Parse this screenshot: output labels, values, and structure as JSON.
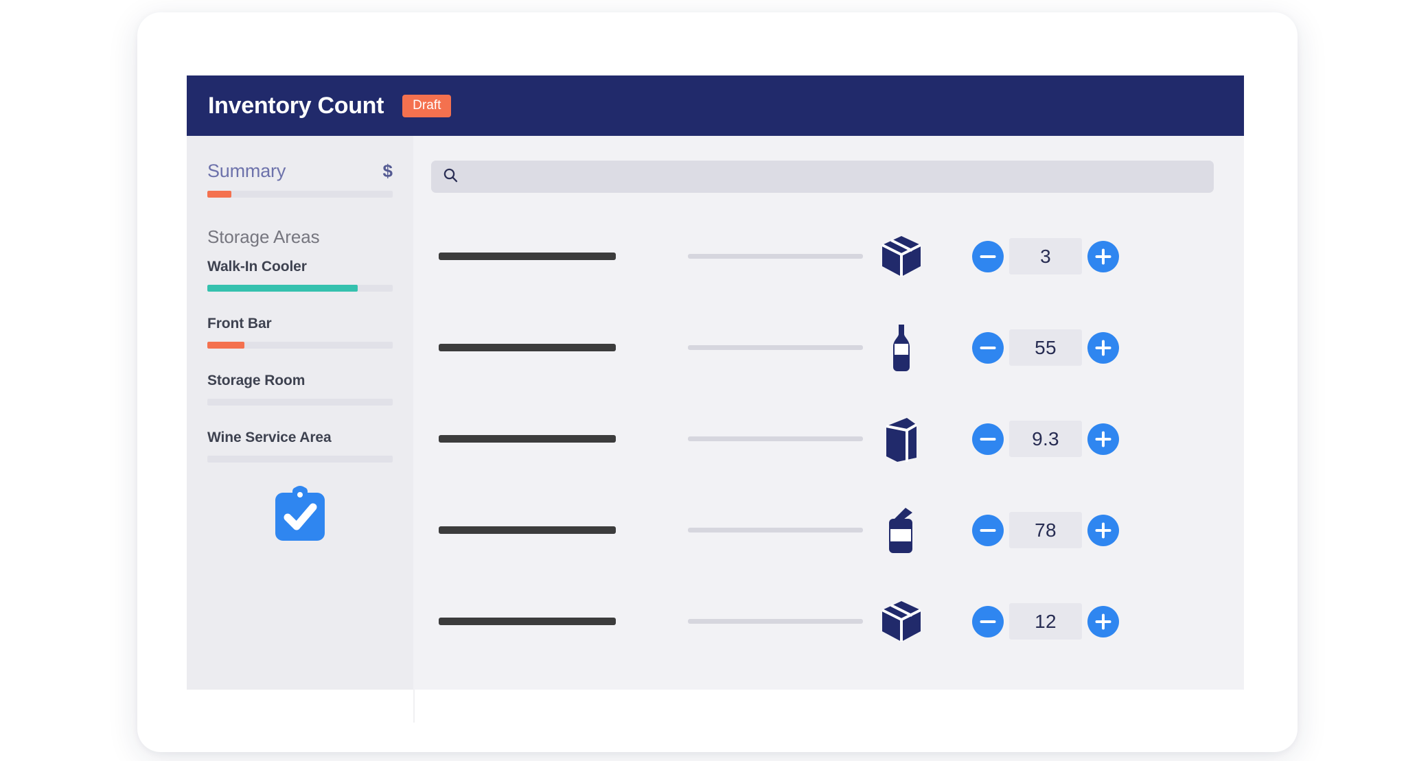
{
  "header": {
    "title": "Inventory Count",
    "status_badge": "Draft",
    "bg_color": "#212a6b",
    "badge_color": "#f4714f"
  },
  "sidebar": {
    "summary": {
      "label": "Summary",
      "currency_icon": "dollar-icon",
      "progress_percent": 13,
      "progress_color": "#f4714f"
    },
    "section_title": "Storage Areas",
    "areas": [
      {
        "name": "Walk-In Cooler",
        "progress_percent": 81,
        "progress_color": "#35c1ae"
      },
      {
        "name": "Front Bar",
        "progress_percent": 20,
        "progress_color": "#f4714f"
      },
      {
        "name": "Storage Room",
        "progress_percent": 0,
        "progress_color": "#e1e1e8"
      },
      {
        "name": "Wine Service Area",
        "progress_percent": 0,
        "progress_color": "#e1e1e8"
      }
    ],
    "clipboard_icon": "clipboard-check-icon",
    "clipboard_color": "#2f86f0"
  },
  "main": {
    "search": {
      "icon": "search-icon",
      "value": "",
      "placeholder": ""
    },
    "stepper": {
      "decrement_icon": "minus-circle-icon",
      "increment_icon": "plus-circle-icon",
      "button_color": "#2f86f0"
    },
    "rows": [
      {
        "icon": "box-package-icon",
        "quantity": "3"
      },
      {
        "icon": "wine-bottle-icon",
        "quantity": "55"
      },
      {
        "icon": "paper-bag-icon",
        "quantity": "9.3"
      },
      {
        "icon": "can-jar-icon",
        "quantity": "78"
      },
      {
        "icon": "box-package-icon",
        "quantity": "12"
      }
    ]
  }
}
